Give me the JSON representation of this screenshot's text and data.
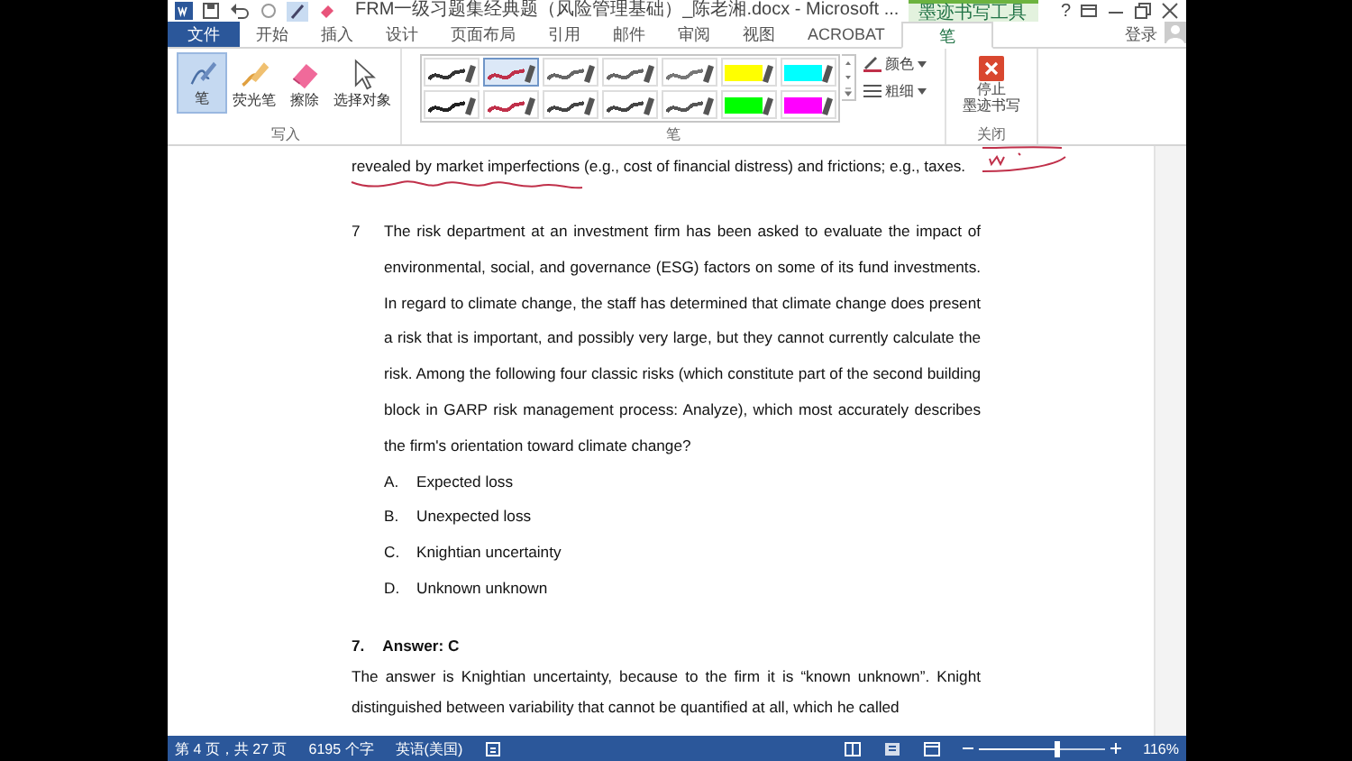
{
  "title_bar": {
    "title": "FRM一级习题集经典题（风险管理基础）_陈老湘.docx - Microsoft ...",
    "contextual_tab": "墨迹书写工具",
    "help": "?"
  },
  "tabs": [
    {
      "label": "文件",
      "kind": "file",
      "selected": false
    },
    {
      "label": "开始",
      "kind": "tab",
      "selected": false
    },
    {
      "label": "插入",
      "kind": "tab",
      "selected": false
    },
    {
      "label": "设计",
      "kind": "tab",
      "selected": false
    },
    {
      "label": "页面布局",
      "kind": "tab",
      "selected": false
    },
    {
      "label": "引用",
      "kind": "tab",
      "selected": false
    },
    {
      "label": "邮件",
      "kind": "tab",
      "selected": false
    },
    {
      "label": "审阅",
      "kind": "tab",
      "selected": false
    },
    {
      "label": "视图",
      "kind": "tab",
      "selected": false
    },
    {
      "label": "ACROBAT",
      "kind": "tab",
      "selected": false
    },
    {
      "label": "笔",
      "kind": "contextual",
      "selected": true
    }
  ],
  "sign_in": "登录",
  "ribbon": {
    "write_group": {
      "label": "写入",
      "tools": [
        {
          "label": "笔",
          "kind": "pen",
          "selected": true
        },
        {
          "label": "荧光笔",
          "kind": "highlighter",
          "selected": false
        },
        {
          "label": "擦除",
          "kind": "eraser",
          "selected": false
        },
        {
          "label": "选择对象",
          "kind": "select",
          "selected": false
        }
      ]
    },
    "pens_group": {
      "label": "笔",
      "color_button": "颜色",
      "weight_button": "粗细",
      "pens": [
        {
          "kind": "pen",
          "color": "#333333",
          "selected": false
        },
        {
          "kind": "pen",
          "color": "#c0304a",
          "selected": true
        },
        {
          "kind": "pen",
          "color": "#666666",
          "selected": false
        },
        {
          "kind": "pen",
          "color": "#666666",
          "selected": false
        },
        {
          "kind": "pen",
          "color": "#777777",
          "selected": false
        },
        {
          "kind": "highlighter",
          "color": "#ffff00",
          "selected": false
        },
        {
          "kind": "highlighter",
          "color": "#00ffff",
          "selected": false
        },
        {
          "kind": "pen",
          "color": "#222222",
          "selected": false
        },
        {
          "kind": "pen",
          "color": "#c0304a",
          "selected": false
        },
        {
          "kind": "pen",
          "color": "#444444",
          "selected": false
        },
        {
          "kind": "pen",
          "color": "#444444",
          "selected": false
        },
        {
          "kind": "pen",
          "color": "#555555",
          "selected": false
        },
        {
          "kind": "highlighter",
          "color": "#00ff00",
          "selected": false
        },
        {
          "kind": "highlighter",
          "color": "#ff00ff",
          "selected": false
        }
      ]
    },
    "close_group": {
      "label": "关闭",
      "button_lines": [
        "停止",
        "墨迹书写"
      ]
    }
  },
  "document": {
    "fragment": "revealed by market imperfections (e.g., cost of financial distress) and frictions; e.g., taxes.",
    "question": {
      "number": "7",
      "text": "The risk department at an investment firm has been asked to evaluate the impact of environmental, social, and governance (ESG) factors on some of its fund investments. In regard to climate change, the staff has determined that climate change does present a risk that is important, and possibly very large, but they cannot currently calculate the risk. Among the following four classic risks (which constitute part of the second building block in GARP risk management process: Analyze), which most accurately describes the firm's orientation toward climate change?",
      "options": [
        {
          "letter": "A.",
          "text": "Expected loss"
        },
        {
          "letter": "B.",
          "text": "Unexpected loss"
        },
        {
          "letter": "C.",
          "text": "Knightian uncertainty"
        },
        {
          "letter": "D.",
          "text": "Unknown unknown"
        }
      ]
    },
    "answer": {
      "number": "7.",
      "heading": "Answer: C",
      "text": "The answer is Knightian uncertainty, because to the firm it is “known unknown”. Knight distinguished between variability that cannot be quantified at all, which he called"
    }
  },
  "status_bar": {
    "page": "第 4 页，共 27 页",
    "words": "6195 个字",
    "language": "英语(美国)",
    "zoom": "116%",
    "zoom_slider": {
      "level": 0.62
    }
  }
}
